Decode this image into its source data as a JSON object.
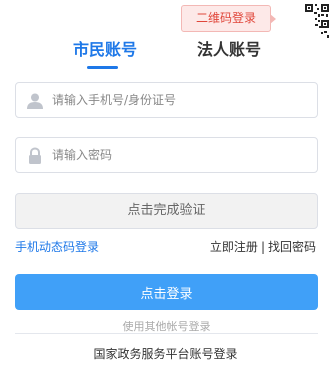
{
  "qr_tip": "二维码登录",
  "tabs": {
    "citizen": "市民账号",
    "legal": "法人账号"
  },
  "form": {
    "account_placeholder": "请输入手机号/身份证号",
    "password_placeholder": "请输入密码",
    "verify_label": "点击完成验证"
  },
  "links": {
    "sms_login": "手机动态码登录",
    "register": "立即注册",
    "separator": "|",
    "forgot": "找回密码"
  },
  "login_button": "点击登录",
  "other_accounts": "使用其他帐号登录",
  "national_login": "国家政务服务平台账号登录",
  "colors": {
    "accent": "#1e78e8",
    "button": "#40a0f8",
    "tip_text": "#e0463a",
    "tip_bg": "#fde9e8"
  },
  "icons": {
    "account": "user-icon",
    "password": "lock-icon",
    "corner": "qr-code-icon"
  }
}
